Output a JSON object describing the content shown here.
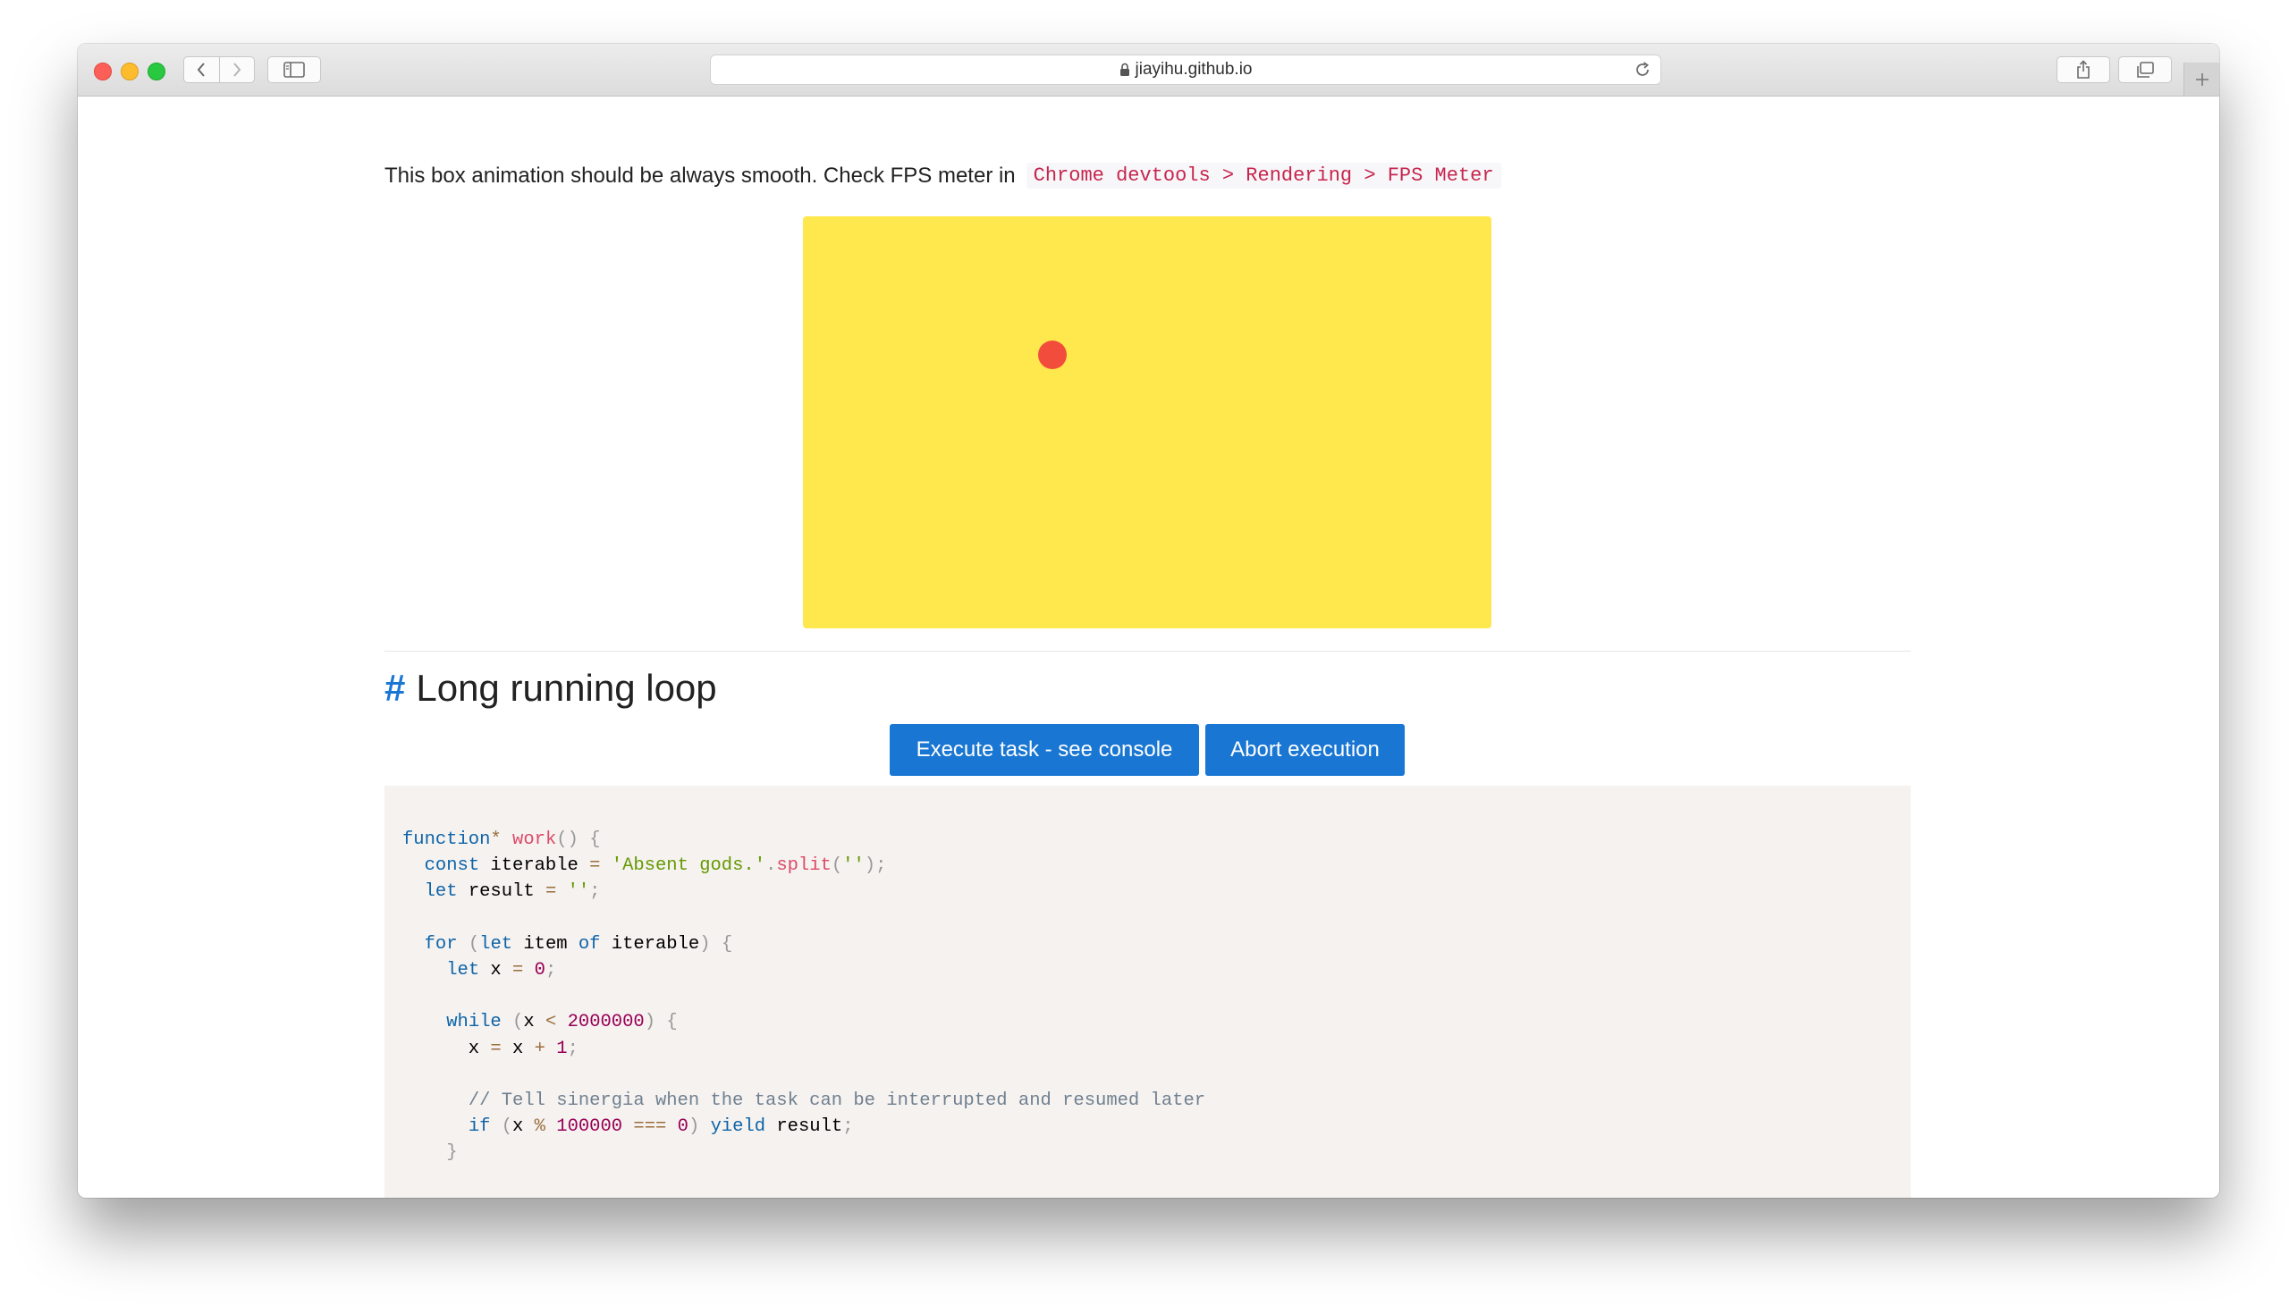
{
  "browser": {
    "url": "jiayihu.github.io",
    "icons": {
      "back": "chevron-left-icon",
      "forward": "chevron-right-icon",
      "sidebar": "sidebar-icon",
      "lock": "lock-icon",
      "reload": "reload-icon",
      "share": "share-icon",
      "tabs": "tabs-overview-icon",
      "new_tab": "plus-icon"
    }
  },
  "page": {
    "intro_text": "This box animation should be always smooth. Check FPS meter in",
    "intro_code": "Chrome devtools > Rendering > FPS Meter",
    "heading_hash": "#",
    "heading": "Long running loop",
    "buttons": {
      "execute": "Execute task - see console",
      "abort": "Abort execution"
    },
    "colors": {
      "box": "#ffe84d",
      "dot": "#f24c3d",
      "button": "#1976d2",
      "accent": "#1976d2"
    },
    "code_lines": [
      "",
      "function* work() {",
      "  const iterable = 'Absent gods.'.split('');",
      "  let result = '';",
      "",
      "  for (let item of iterable) {",
      "    let x = 0;",
      "",
      "    while (x < 2000000) {",
      "      x = x + 1;",
      "",
      "      // Tell sinergia when the task can be interrupted and resumed later",
      "      if (x % 100000 === 0) yield result;",
      "    }"
    ]
  }
}
